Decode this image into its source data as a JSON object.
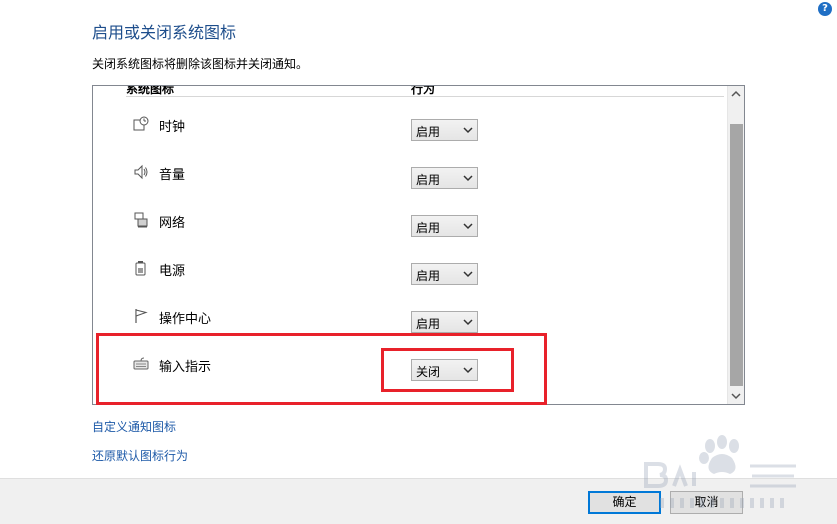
{
  "dialog": {
    "title": "启用或关闭系统图标",
    "description": "关闭系统图标将删除该图标并关闭通知。"
  },
  "table": {
    "headers": [
      "系统图标",
      "行为"
    ],
    "rows": [
      {
        "label": "时钟",
        "icon": "clock-icon",
        "value": "启用"
      },
      {
        "label": "音量",
        "icon": "volume-icon",
        "value": "启用"
      },
      {
        "label": "网络",
        "icon": "network-icon",
        "value": "启用"
      },
      {
        "label": "电源",
        "icon": "power-icon",
        "value": "启用"
      },
      {
        "label": "操作中心",
        "icon": "flag-icon",
        "value": "启用"
      },
      {
        "label": "输入指示",
        "icon": "keyboard-icon",
        "value": "关闭"
      }
    ]
  },
  "links": {
    "customize": "自定义通知图标",
    "restore": "还原默认图标行为"
  },
  "buttons": {
    "ok": "确定",
    "cancel": "取消"
  },
  "colors": {
    "title": "#1e4e8c",
    "link": "#1e5aa8",
    "highlight": "#e8212a"
  }
}
